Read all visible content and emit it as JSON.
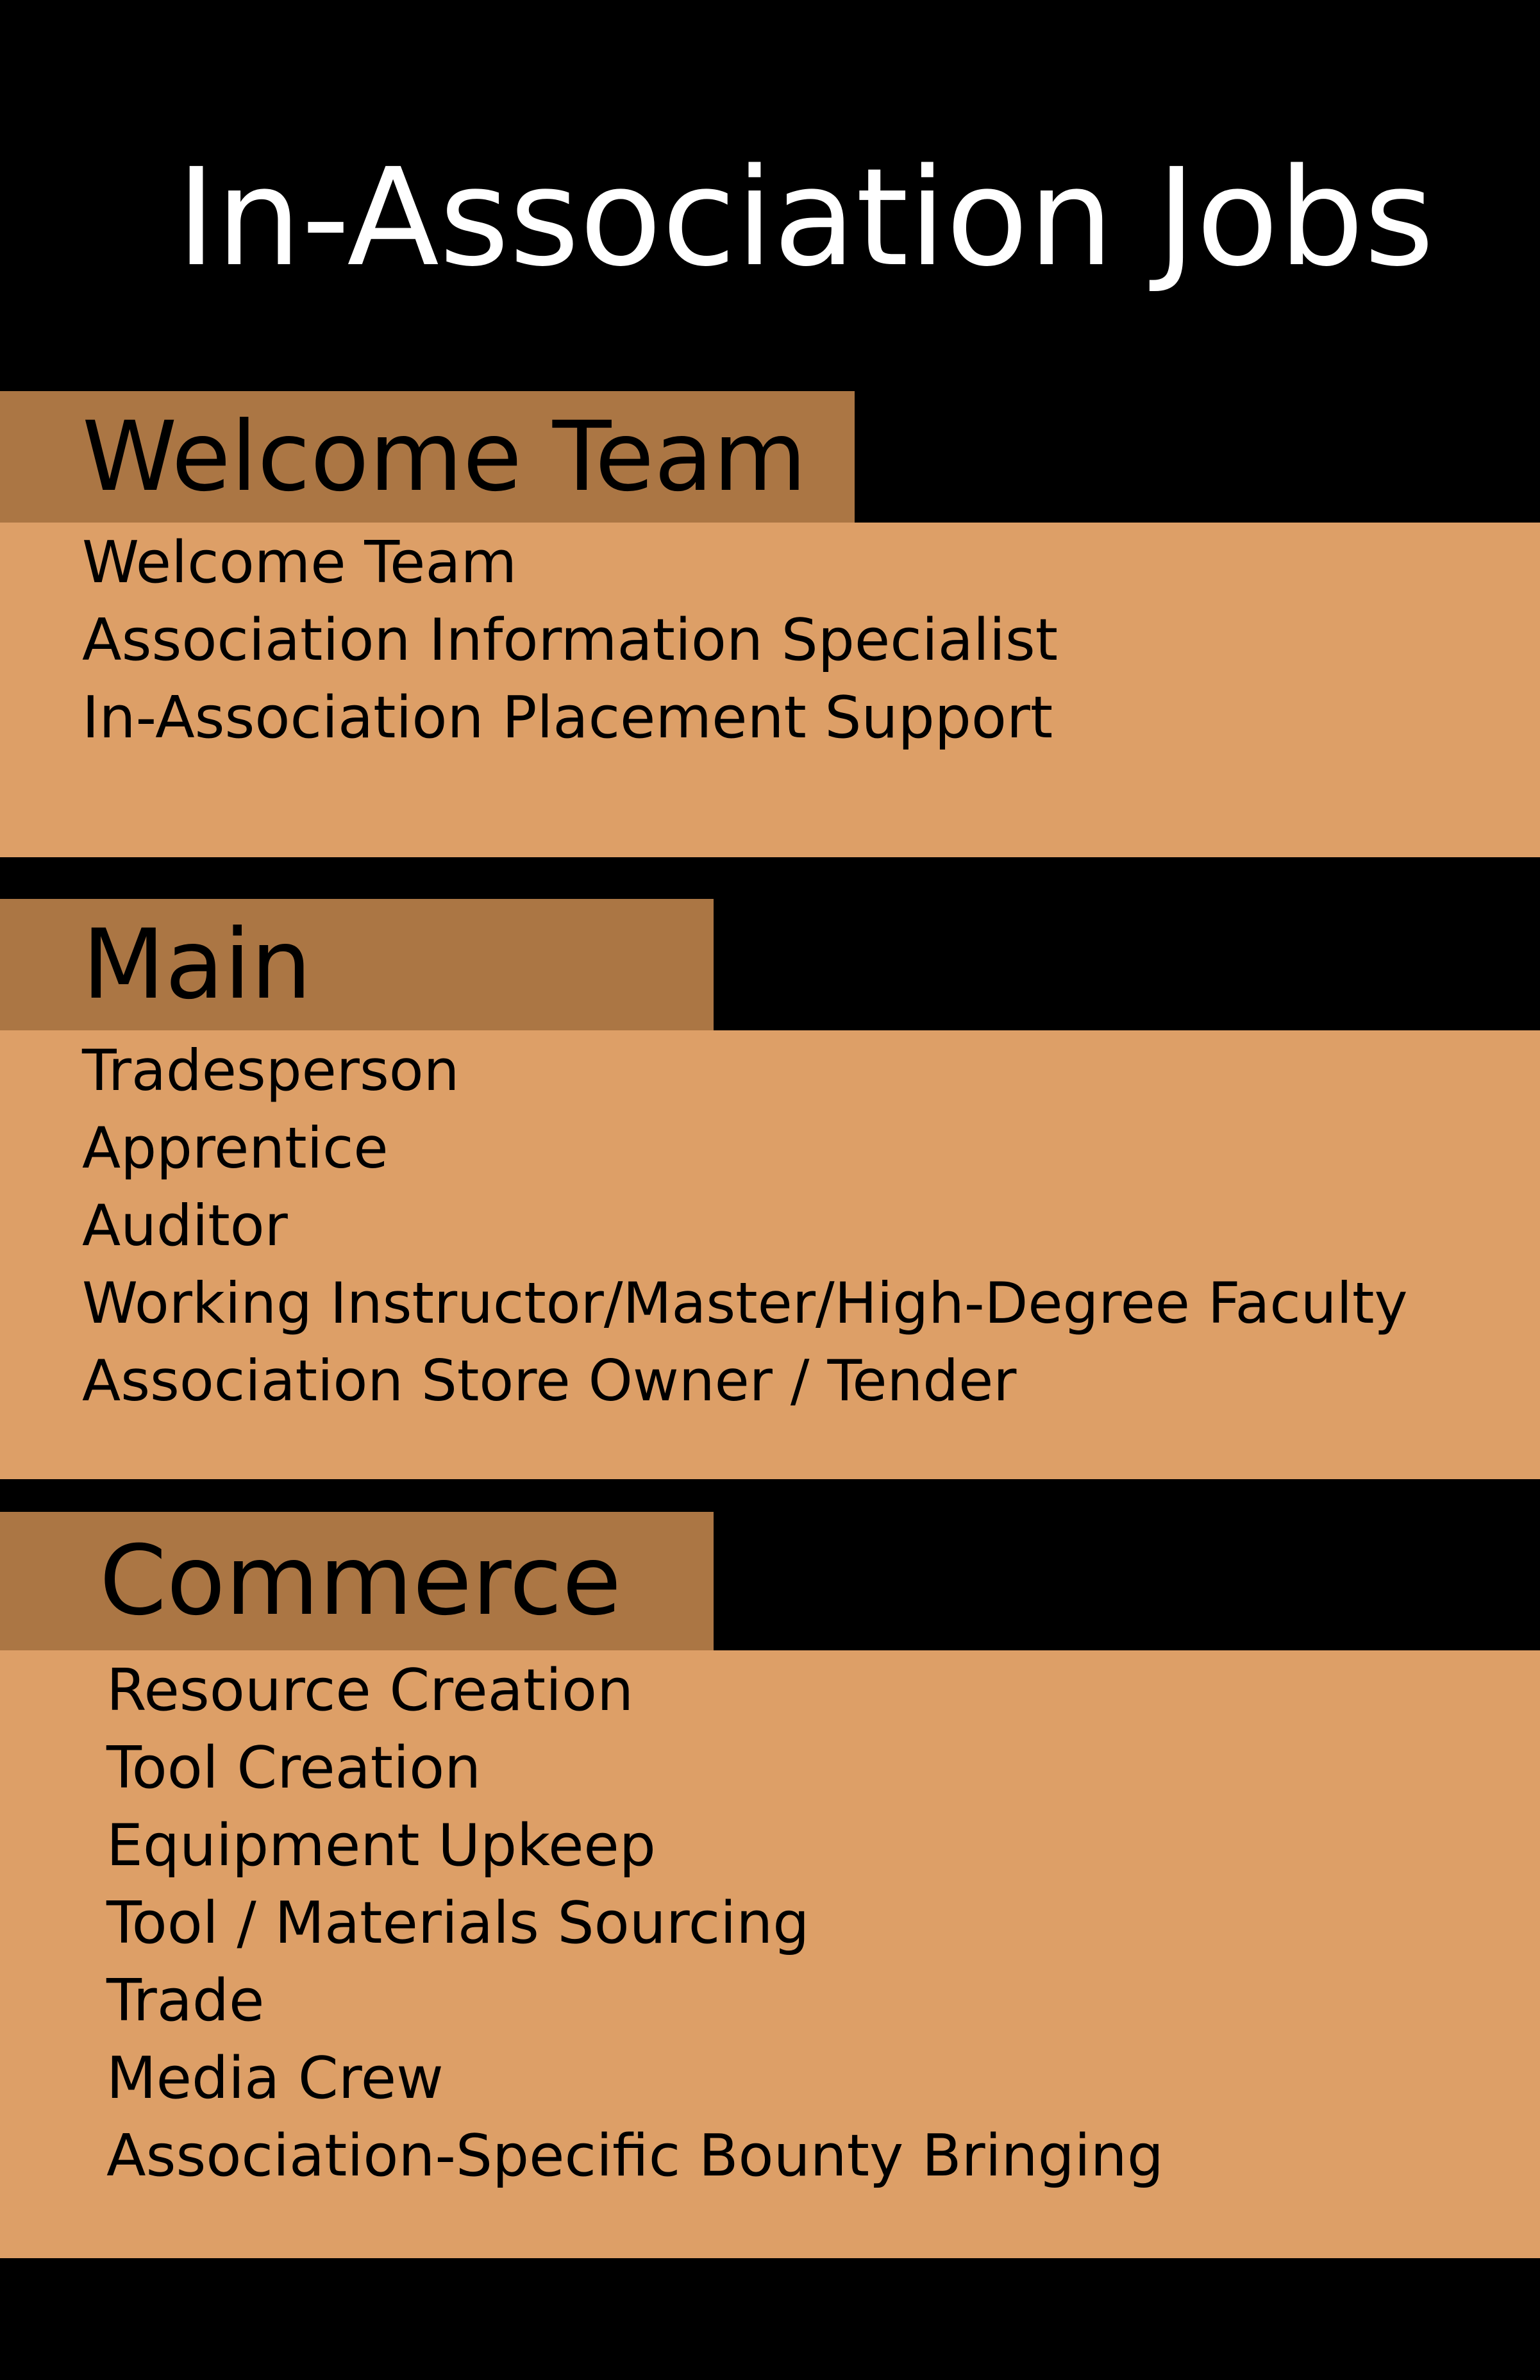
{
  "title": "In-Association Jobs",
  "colors": {
    "background": "#000000",
    "section_tab": "#ab7644",
    "section_panel": "#dd9f67",
    "title_text": "#ffffff",
    "body_text": "#000000"
  },
  "sections": [
    {
      "heading": "Welcome Team",
      "items": [
        "Welcome Team",
        "Association Information Specialist",
        "In-Association Placement Support"
      ]
    },
    {
      "heading": "Main",
      "items": [
        "Tradesperson",
        "Apprentice",
        "Auditor",
        "Working Instructor/Master/High-Degree Faculty",
        "Association Store Owner / Tender"
      ]
    },
    {
      "heading": "Commerce",
      "items": [
        "Resource Creation",
        "Tool Creation",
        "Equipment Upkeep",
        "Tool / Materials Sourcing",
        "Trade",
        "Media Crew",
        "Association-Specific Bounty Bringing"
      ]
    }
  ]
}
